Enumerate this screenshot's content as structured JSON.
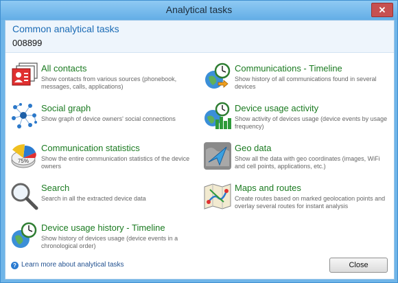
{
  "window": {
    "title": "Analytical tasks",
    "close_glyph": "✕"
  },
  "header": {
    "heading": "Common analytical tasks",
    "case_id": "008899"
  },
  "tasks": [
    {
      "title": "All contacts",
      "description": "Show contacts from various sources (phonebook, messages, calls, applications)",
      "icon": "contacts-icon"
    },
    {
      "title": "Communications - Timeline",
      "description": "Show history of all communications found in several devices",
      "icon": "globe-clock-icon"
    },
    {
      "title": "Social graph",
      "description": "Show graph of device owners' social connections",
      "icon": "social-graph-icon"
    },
    {
      "title": "Device usage activity",
      "description": "Show activity of devices usage (device events by usage frequency)",
      "icon": "usage-chart-clock-icon"
    },
    {
      "title": "Communication statistics",
      "description": "Show the entire communication statistics of the device owners",
      "icon": "pie-chart-icon",
      "icon_label": "75%"
    },
    {
      "title": "Geo data",
      "description": "Show all the data with geo coordinates (images, WiFi and cell points, applications, etc.)",
      "icon": "geo-arrow-icon"
    },
    {
      "title": "Search",
      "description": "Search in all the extracted device data",
      "icon": "magnifier-icon"
    },
    {
      "title": "Maps and routes",
      "description": "Create routes based on marked geolocation points and overlay several routes for instant analysis",
      "icon": "map-route-icon"
    },
    {
      "title": "Device usage history - Timeline",
      "description": "Show history of devices usage (device events in a chronological order)",
      "icon": "globe-clock-icon"
    }
  ],
  "footer": {
    "help_link": "Learn more about analytical tasks",
    "help_icon": "?",
    "close_label": "Close"
  },
  "colors": {
    "accent": "#1b6bb5",
    "task_title": "#1a7a20",
    "frame": "#6fb5e8"
  }
}
